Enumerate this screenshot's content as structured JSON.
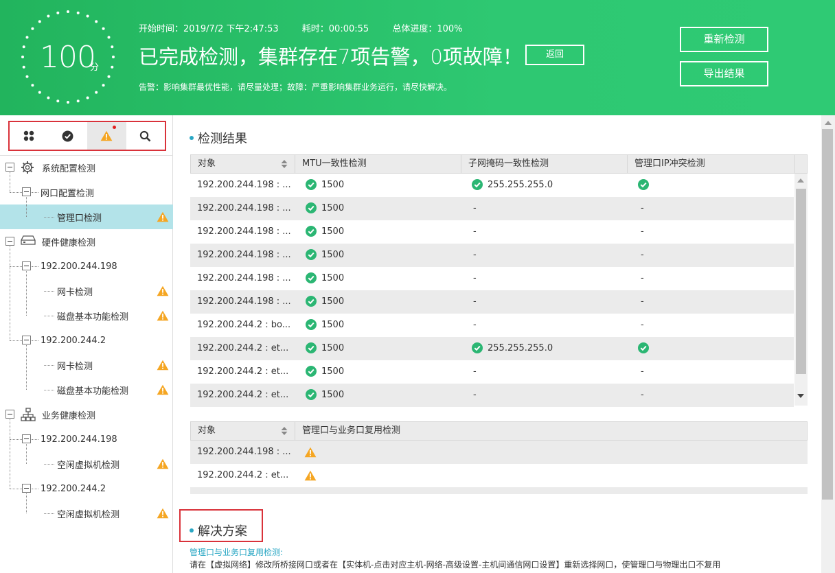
{
  "header": {
    "score": "100",
    "score_unit": "分",
    "start_time": "开始时间：2019/7/2 下午2:47:53",
    "elapsed": "耗时：00:00:55",
    "progress": "总体进度：100%",
    "headline": "已完成检测，集群存在7项告警，0项故障！",
    "back_label": "返回",
    "legend": "告警：影响集群最优性能，请尽量处理；故障：严重影响集群业务运行，请尽快解决。",
    "recheck_label": "重新检测",
    "export_label": "导出结果"
  },
  "tabs": [
    {
      "icon": "grid-icon"
    },
    {
      "icon": "check-icon"
    },
    {
      "icon": "warning-icon",
      "active": true,
      "has_dot": true
    },
    {
      "icon": "search-icon"
    }
  ],
  "tree": [
    {
      "label": "系统配置检测",
      "icon": "gear-icon",
      "level": 0,
      "warn": false
    },
    {
      "label": "网口配置检测",
      "level": 1,
      "warn": false
    },
    {
      "label": "管理口检测",
      "level": 2,
      "warn": true,
      "selected": true
    },
    {
      "label": "硬件健康检测",
      "icon": "hardware-icon",
      "level": 0,
      "warn": false
    },
    {
      "label": "192.200.244.198",
      "level": 1,
      "warn": false
    },
    {
      "label": "网卡检测",
      "level": 2,
      "warn": true
    },
    {
      "label": "磁盘基本功能检测",
      "level": 2,
      "warn": true
    },
    {
      "label": "192.200.244.2",
      "level": 1,
      "warn": false
    },
    {
      "label": "网卡检测",
      "level": 2,
      "warn": true
    },
    {
      "label": "磁盘基本功能检测",
      "level": 2,
      "warn": true
    },
    {
      "label": "业务健康检测",
      "icon": "network-icon",
      "level": 0,
      "warn": false
    },
    {
      "label": "192.200.244.198",
      "level": 1,
      "warn": false
    },
    {
      "label": "空闲虚拟机检测",
      "level": 2,
      "warn": true
    },
    {
      "label": "192.200.244.2",
      "level": 1,
      "warn": false
    },
    {
      "label": "空闲虚拟机检测",
      "level": 2,
      "warn": true
    }
  ],
  "results": {
    "title": "检测结果",
    "table1": {
      "headers": [
        "对象",
        "MTU一致性检测",
        "子网掩码一致性检测",
        "管理口IP冲突检测"
      ],
      "rows": [
        {
          "object": "192.200.244.198 : ...",
          "mtu": "1500",
          "mask": "255.255.255.0",
          "mask_ok": true,
          "ip_ok": true,
          "ip": ""
        },
        {
          "object": "192.200.244.198 : ...",
          "mtu": "1500",
          "mask": "-",
          "mask_ok": false,
          "ip_ok": false,
          "ip": "-"
        },
        {
          "object": "192.200.244.198 : ...",
          "mtu": "1500",
          "mask": "-",
          "mask_ok": false,
          "ip_ok": false,
          "ip": "-"
        },
        {
          "object": "192.200.244.198 : ...",
          "mtu": "1500",
          "mask": "-",
          "mask_ok": false,
          "ip_ok": false,
          "ip": "-"
        },
        {
          "object": "192.200.244.198 : ...",
          "mtu": "1500",
          "mask": "-",
          "mask_ok": false,
          "ip_ok": false,
          "ip": "-"
        },
        {
          "object": "192.200.244.198 : ...",
          "mtu": "1500",
          "mask": "-",
          "mask_ok": false,
          "ip_ok": false,
          "ip": "-"
        },
        {
          "object": "192.200.244.2 : bo...",
          "mtu": "1500",
          "mask": "-",
          "mask_ok": false,
          "ip_ok": false,
          "ip": "-"
        },
        {
          "object": "192.200.244.2 : et...",
          "mtu": "1500",
          "mask": "255.255.255.0",
          "mask_ok": true,
          "ip_ok": true,
          "ip": ""
        },
        {
          "object": "192.200.244.2 : et...",
          "mtu": "1500",
          "mask": "-",
          "mask_ok": false,
          "ip_ok": false,
          "ip": "-"
        },
        {
          "object": "192.200.244.2 : et...",
          "mtu": "1500",
          "mask": "-",
          "mask_ok": false,
          "ip_ok": false,
          "ip": "-"
        }
      ]
    },
    "table2": {
      "headers": [
        "对象",
        "管理口与业务口复用检测"
      ],
      "rows": [
        {
          "object": "192.200.244.198 : ...",
          "warn": true
        },
        {
          "object": "192.200.244.2 : et...",
          "warn": true
        }
      ]
    }
  },
  "solution": {
    "title": "解决方案",
    "link": "管理口与业务口复用检测:",
    "text": "请在【虚拟网络】修改所桥接网口或者在【实体机-点击对应主机-网络-高级设置-主机间通信网口设置】重新选择网口，使管理口与物理出口不复用"
  },
  "colors": {
    "header_green": "#2ec872",
    "ok_green": "#2bb673",
    "warn_orange": "#f5a623",
    "accent_teal": "#2aa7c4",
    "highlight_red": "#d9323a"
  }
}
